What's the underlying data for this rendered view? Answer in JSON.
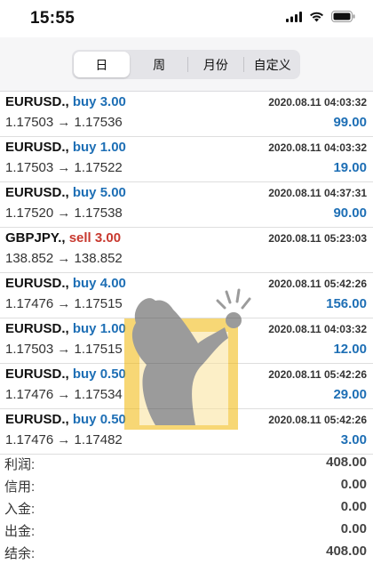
{
  "status_bar": {
    "time": "15:55"
  },
  "tabs": [
    {
      "label": "日",
      "active": true
    },
    {
      "label": "周",
      "active": false
    },
    {
      "label": "月份",
      "active": false
    },
    {
      "label": "自定义",
      "active": false
    }
  ],
  "trades": [
    {
      "symbol": "EURUSD.,",
      "side": "buy 3.00",
      "side_type": "buy",
      "datetime": "2020.08.11 04:03:32",
      "prices": "1.17503 → 1.17536",
      "profit": "99.00"
    },
    {
      "symbol": "EURUSD.,",
      "side": "buy 1.00",
      "side_type": "buy",
      "datetime": "2020.08.11 04:03:32",
      "prices": "1.17503 → 1.17522",
      "profit": "19.00"
    },
    {
      "symbol": "EURUSD.,",
      "side": "buy 5.00",
      "side_type": "buy",
      "datetime": "2020.08.11 04:37:31",
      "prices": "1.17520 → 1.17538",
      "profit": "90.00"
    },
    {
      "symbol": "GBPJPY.,",
      "side": "sell 3.00",
      "side_type": "sell",
      "datetime": "2020.08.11 05:23:03",
      "prices": "138.852 → 138.852",
      "profit": ""
    },
    {
      "symbol": "EURUSD.,",
      "side": "buy 4.00",
      "side_type": "buy",
      "datetime": "2020.08.11 05:42:26",
      "prices": "1.17476 → 1.17515",
      "profit": "156.00"
    },
    {
      "symbol": "EURUSD.,",
      "side": "buy 1.00",
      "side_type": "buy",
      "datetime": "2020.08.11 04:03:32",
      "prices": "1.17503 → 1.17515",
      "profit": "12.00"
    },
    {
      "symbol": "EURUSD.,",
      "side": "buy 0.50",
      "side_type": "buy",
      "datetime": "2020.08.11 05:42:26",
      "prices": "1.17476 → 1.17534",
      "profit": "29.00"
    },
    {
      "symbol": "EURUSD.,",
      "side": "buy 0.50",
      "side_type": "buy",
      "datetime": "2020.08.11 05:42:26",
      "prices": "1.17476 → 1.17482",
      "profit": "3.00"
    }
  ],
  "summary": [
    {
      "label": "利润:",
      "value": "408.00"
    },
    {
      "label": "信用:",
      "value": "0.00"
    },
    {
      "label": "入金:",
      "value": "0.00"
    },
    {
      "label": "出金:",
      "value": "0.00"
    },
    {
      "label": "结余:",
      "value": "408.00"
    }
  ],
  "colors": {
    "buy": "#1e6fb5",
    "sell": "#c8392f",
    "watermark_accent": "#f2b705"
  },
  "icons": [
    "cellular-signal-icon",
    "wifi-icon",
    "battery-icon",
    "watermark-logo"
  ]
}
